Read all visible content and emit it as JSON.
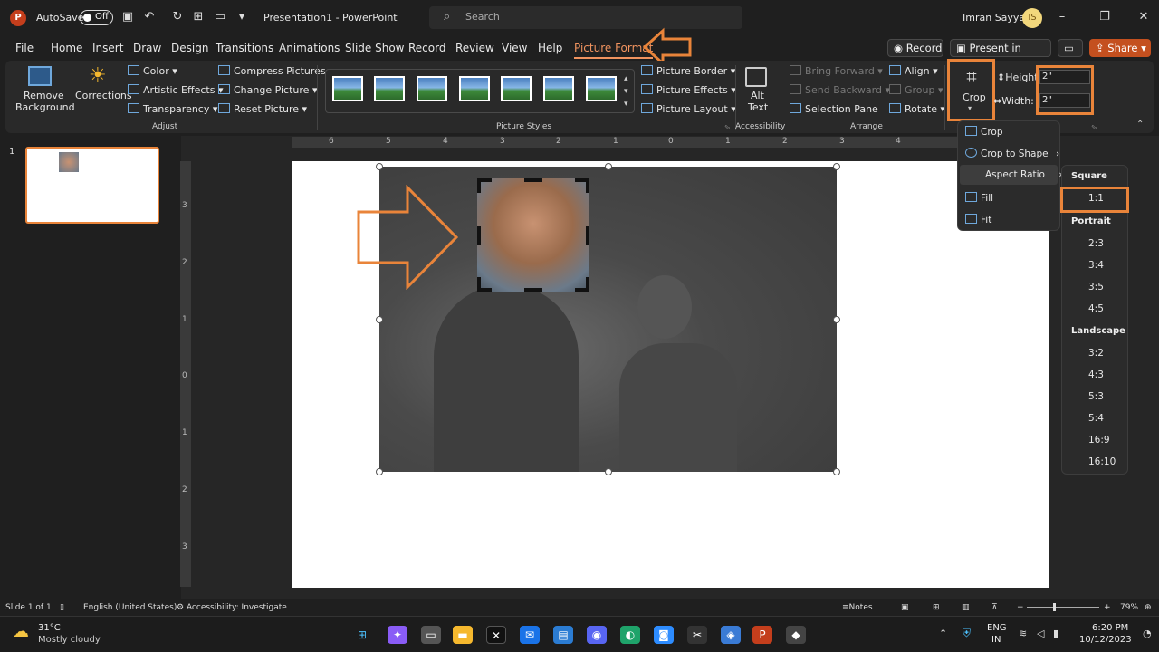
{
  "titlebar": {
    "autosave": "AutoSave",
    "toggle": "Off",
    "doc_title": "Presentation1 - PowerPoint",
    "search_placeholder": "Search",
    "user": "Imran Sayyad"
  },
  "tabs": [
    "File",
    "Home",
    "Insert",
    "Draw",
    "Design",
    "Transitions",
    "Animations",
    "Slide Show",
    "Record",
    "Review",
    "View",
    "Help",
    "Picture Format"
  ],
  "right_buttons": {
    "record": "Record",
    "teams": "Present in Teams",
    "share": "Share"
  },
  "ribbon": {
    "remove_bg": [
      "Remove",
      "Background"
    ],
    "corrections": "Corrections",
    "color": "Color",
    "artistic": "Artistic Effects",
    "transparency": "Transparency",
    "compress": "Compress Pictures",
    "change": "Change Picture",
    "reset": "Reset Picture",
    "border": "Picture Border",
    "effects": "Picture Effects",
    "layout": "Picture Layout",
    "alt": [
      "Alt",
      "Text"
    ],
    "bring": "Bring Forward",
    "send": "Send Backward",
    "selection": "Selection Pane",
    "align": "Align",
    "group": "Group",
    "rotate": "Rotate",
    "crop": "Crop",
    "height_label": "Height:",
    "width_label": "Width:",
    "height_value": "2\"",
    "width_value": "2\"",
    "groups": {
      "adjust": "Adjust",
      "styles": "Picture Styles",
      "accessibility": "Accessibility",
      "arrange": "Arrange"
    }
  },
  "slide_number": "1",
  "ruler_h": [
    "6",
    "5",
    "4",
    "3",
    "2",
    "1",
    "0",
    "1",
    "2",
    "3",
    "4"
  ],
  "ruler_v": [
    "3",
    "2",
    "1",
    "0",
    "1",
    "2",
    "3"
  ],
  "crop_menu": [
    "Crop",
    "Crop to Shape",
    "Aspect Ratio",
    "Fill",
    "Fit"
  ],
  "aspect_menu": {
    "square_header": "Square",
    "square": [
      "1:1"
    ],
    "portrait_header": "Portrait",
    "portrait": [
      "2:3",
      "3:4",
      "3:5",
      "4:5"
    ],
    "landscape_header": "Landscape",
    "landscape": [
      "3:2",
      "4:3",
      "5:3",
      "5:4",
      "16:9",
      "16:10"
    ]
  },
  "status": {
    "slide": "Slide 1 of 1",
    "language": "English (United States)",
    "accessibility": "Accessibility: Investigate",
    "notes": "Notes",
    "zoom": "79%"
  },
  "taskbar": {
    "temp": "31°C",
    "weather": "Mostly cloudy",
    "lang1": "ENG",
    "lang2": "IN",
    "time": "6:20 PM",
    "date": "10/12/2023"
  },
  "colors": {
    "accent": "#e9843a",
    "tab_active": "#f0935f"
  }
}
